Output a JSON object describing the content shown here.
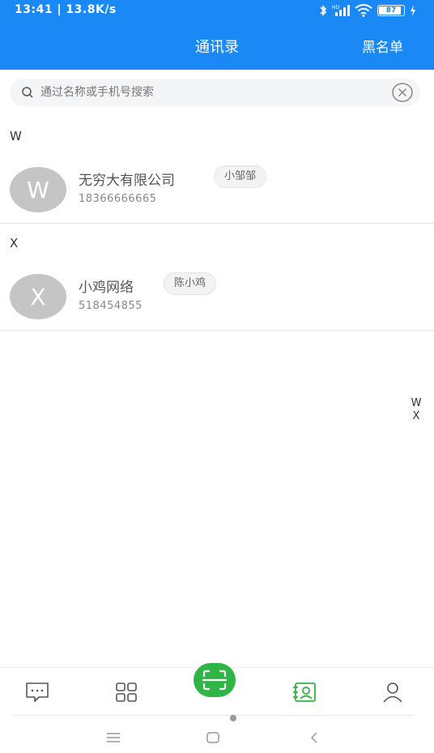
{
  "status_bar": {
    "time": "13:41 | 13.8K/s",
    "battery": "87"
  },
  "header": {
    "title": "通讯录",
    "blacklist_label": "黑名单"
  },
  "search": {
    "placeholder": "通过名称或手机号搜索",
    "value": ""
  },
  "sections": [
    {
      "letter": "W",
      "contacts": [
        {
          "initial": "W",
          "name": "无穷大有限公司",
          "tag": "小邹邹",
          "phone": "18366666665"
        }
      ]
    },
    {
      "letter": "X",
      "contacts": [
        {
          "initial": "X",
          "name": "小鸡网络",
          "tag": "陈小鸡",
          "phone": "518454855"
        }
      ]
    }
  ],
  "index_letters": [
    "W",
    "X"
  ],
  "colors": {
    "header_blue": "#1a88f5",
    "scan_green": "#2fb546",
    "active_green": "#2fb546",
    "avatar_gray": "#c5c5c5"
  },
  "bottom_nav": {
    "items": [
      "message-icon",
      "grid-icon",
      "scan-icon",
      "contacts-icon",
      "profile-icon"
    ],
    "active": "contacts-icon"
  }
}
